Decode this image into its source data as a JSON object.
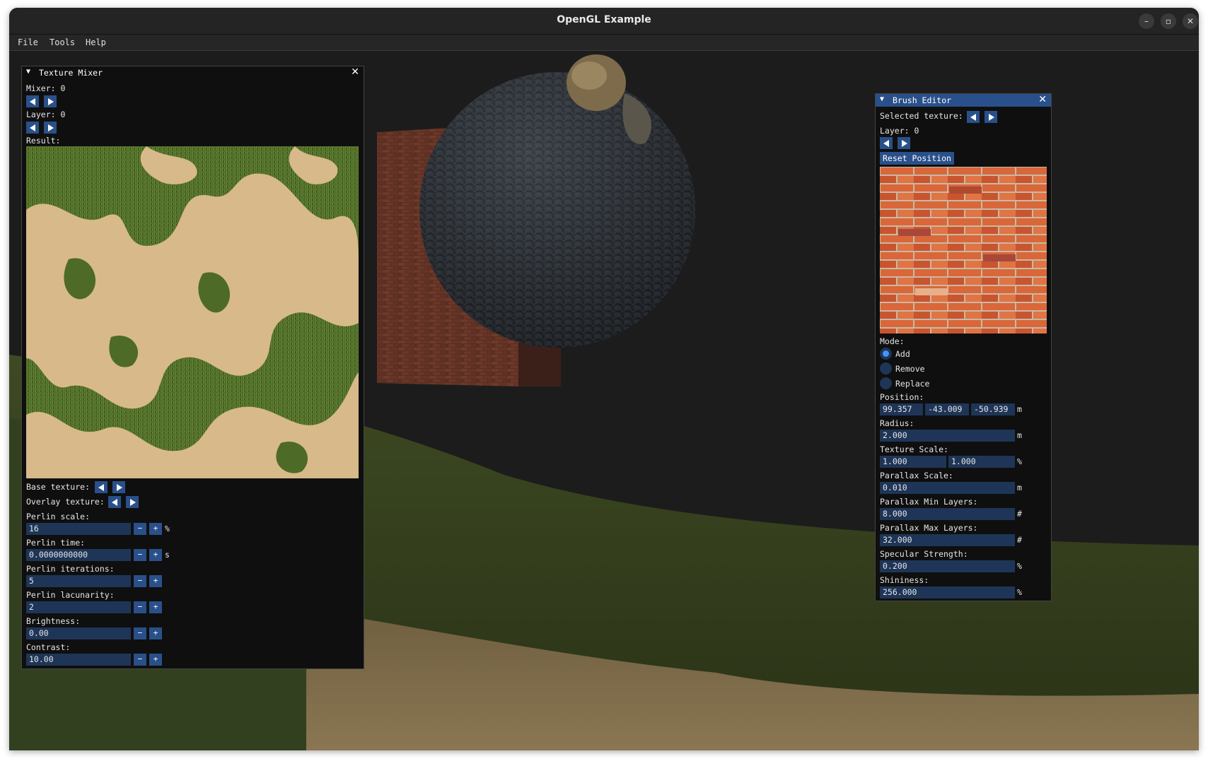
{
  "window": {
    "title": "OpenGL Example"
  },
  "window_controls": {
    "minimize": "–",
    "maximize": "▫",
    "close": "✕"
  },
  "menu": [
    "File",
    "Tools",
    "Help"
  ],
  "texture_mixer": {
    "title": "Texture Mixer",
    "close": "✕",
    "mixer_label": "Mixer: 0",
    "layer_label": "Layer: 0",
    "result_label": "Result:",
    "base_texture_label": "Base texture:",
    "overlay_texture_label": "Overlay texture:",
    "fields": [
      {
        "label": "Perlin scale:",
        "value": "16",
        "unit": "%"
      },
      {
        "label": "Perlin time:",
        "value": "0.0000000000",
        "unit": "s"
      },
      {
        "label": "Perlin iterations:",
        "value": "5",
        "unit": ""
      },
      {
        "label": "Perlin lacunarity:",
        "value": "2",
        "unit": ""
      },
      {
        "label": "Brightness:",
        "value": "0.00",
        "unit": ""
      },
      {
        "label": "Contrast:",
        "value": "10.00",
        "unit": ""
      }
    ],
    "minus": "−",
    "plus": "+"
  },
  "brush_editor": {
    "title": "Brush Editor",
    "close": "✕",
    "selected_texture_label": "Selected texture:",
    "layer_label": "Layer: 0",
    "reset_button": "Reset Position",
    "mode_label": "Mode:",
    "modes": [
      {
        "label": "Add",
        "selected": true
      },
      {
        "label": "Remove",
        "selected": false
      },
      {
        "label": "Replace",
        "selected": false
      }
    ],
    "position_label": "Position:",
    "position": [
      "99.357",
      "-43.009",
      "-50.939"
    ],
    "position_unit": "m",
    "radius_label": "Radius:",
    "radius": "2.000",
    "radius_unit": "m",
    "texture_scale_label": "Texture Scale:",
    "texture_scale": [
      "1.000",
      "1.000"
    ],
    "texture_scale_unit": "%",
    "parallax_scale_label": "Parallax Scale:",
    "parallax_scale": "0.010",
    "parallax_scale_unit": "m",
    "parallax_min_label": "Parallax Min Layers:",
    "parallax_min": "8.000",
    "parallax_min_unit": "#",
    "parallax_max_label": "Parallax Max Layers:",
    "parallax_max": "32.000",
    "parallax_max_unit": "#",
    "specular_label": "Specular Strength:",
    "specular": "0.200",
    "specular_unit": "%",
    "shininess_label": "Shininess:",
    "shininess": "256.000",
    "shininess_unit": "%"
  },
  "colors": {
    "accent": "#29508a",
    "field_bg": "#1e3557",
    "panel_bg": "#0f0f0f",
    "radio_active": "#4296fa"
  }
}
